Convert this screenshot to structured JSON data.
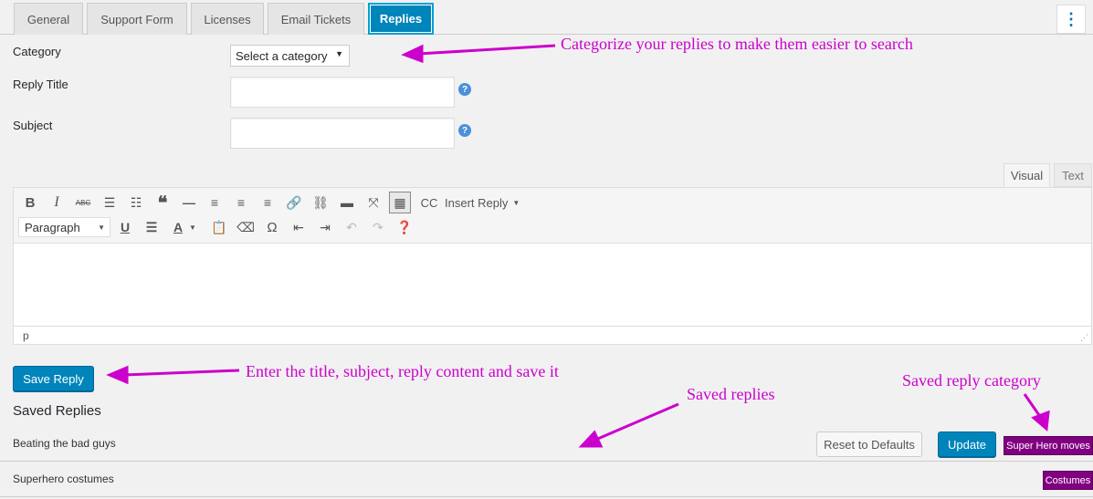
{
  "tabs": [
    {
      "label": "General"
    },
    {
      "label": "Support Form"
    },
    {
      "label": "Licenses"
    },
    {
      "label": "Email Tickets"
    },
    {
      "label": "Replies",
      "active": true
    }
  ],
  "menu_icon": "kebab-menu-icon",
  "form": {
    "category_label": "Category",
    "category_selected": "Select a category",
    "reply_title_label": "Reply Title",
    "reply_title_value": "",
    "subject_label": "Subject",
    "subject_value": "",
    "help_glyph": "?"
  },
  "editor": {
    "tab_visual": "Visual",
    "tab_text": "Text",
    "cc_label": "CC",
    "insert_reply_label": "Insert Reply",
    "format_selected": "Paragraph",
    "status_path": "p",
    "row1_icons": [
      "bold-icon",
      "italic-icon",
      "strikethrough-icon",
      "bullet-list-icon",
      "numbered-list-icon",
      "blockquote-icon",
      "horizontal-rule-icon",
      "align-left-icon",
      "align-center-icon",
      "align-right-icon",
      "link-icon",
      "unlink-icon",
      "read-more-icon",
      "fullscreen-icon",
      "toolbar-toggle-icon"
    ],
    "row2_icons": [
      "underline-icon",
      "justify-icon",
      "text-color-icon",
      "paste-text-icon",
      "clear-formatting-icon",
      "special-character-icon",
      "outdent-icon",
      "indent-icon",
      "undo-icon",
      "redo-icon",
      "help-icon"
    ]
  },
  "save_button": "Save Reply",
  "saved_replies": {
    "heading": "Saved Replies",
    "reset_button": "Reset to Defaults",
    "update_button": "Update",
    "rows": [
      {
        "title": "Beating the bad guys",
        "category": "Super Hero moves"
      },
      {
        "title": "Superhero costumes",
        "category": "Costumes"
      }
    ]
  },
  "annotations": {
    "category_note": "Categorize your replies to make them easier to search",
    "save_note": "Enter the title, subject, reply content and save it",
    "saved_note": "Saved replies",
    "category_badge_note": "Saved reply category"
  },
  "colors": {
    "accent": "#0085ba",
    "annotation": "#cc00cc",
    "badge": "#800080"
  }
}
